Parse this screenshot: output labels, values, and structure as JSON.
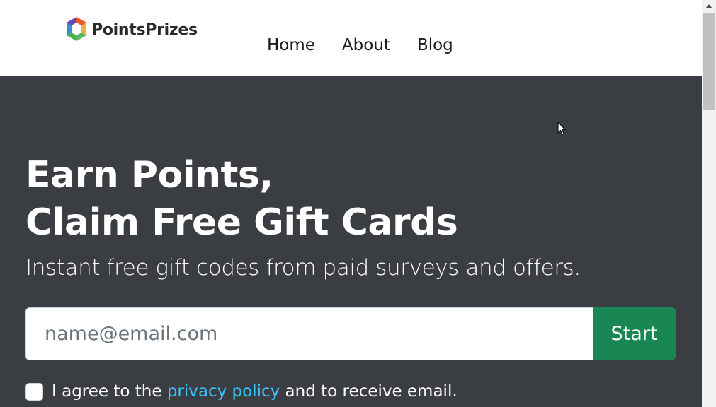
{
  "brand": {
    "name": "PointsPrizes",
    "logo_icon": "hexagon-logo-icon",
    "colors": [
      "#e8562a",
      "#3c8dc5",
      "#5cb85c",
      "#f0ad4e",
      "#6f42c1"
    ]
  },
  "nav": {
    "items": [
      {
        "label": "Home"
      },
      {
        "label": "About"
      },
      {
        "label": "Blog"
      }
    ]
  },
  "hero": {
    "title_line_1": "Earn Points,",
    "title_line_2": "Claim Free Gift Cards",
    "subtitle": "Instant free gift codes from paid surveys and offers.",
    "background": "#3a3d41"
  },
  "signup": {
    "email_placeholder": "name@email.com",
    "email_value": "",
    "start_label": "Start",
    "start_color": "#198754"
  },
  "agree": {
    "checked": false,
    "text_before": "I agree to the ",
    "link_text": "privacy policy",
    "text_after": " and to receive email.",
    "link_color": "#3dc4ff"
  }
}
